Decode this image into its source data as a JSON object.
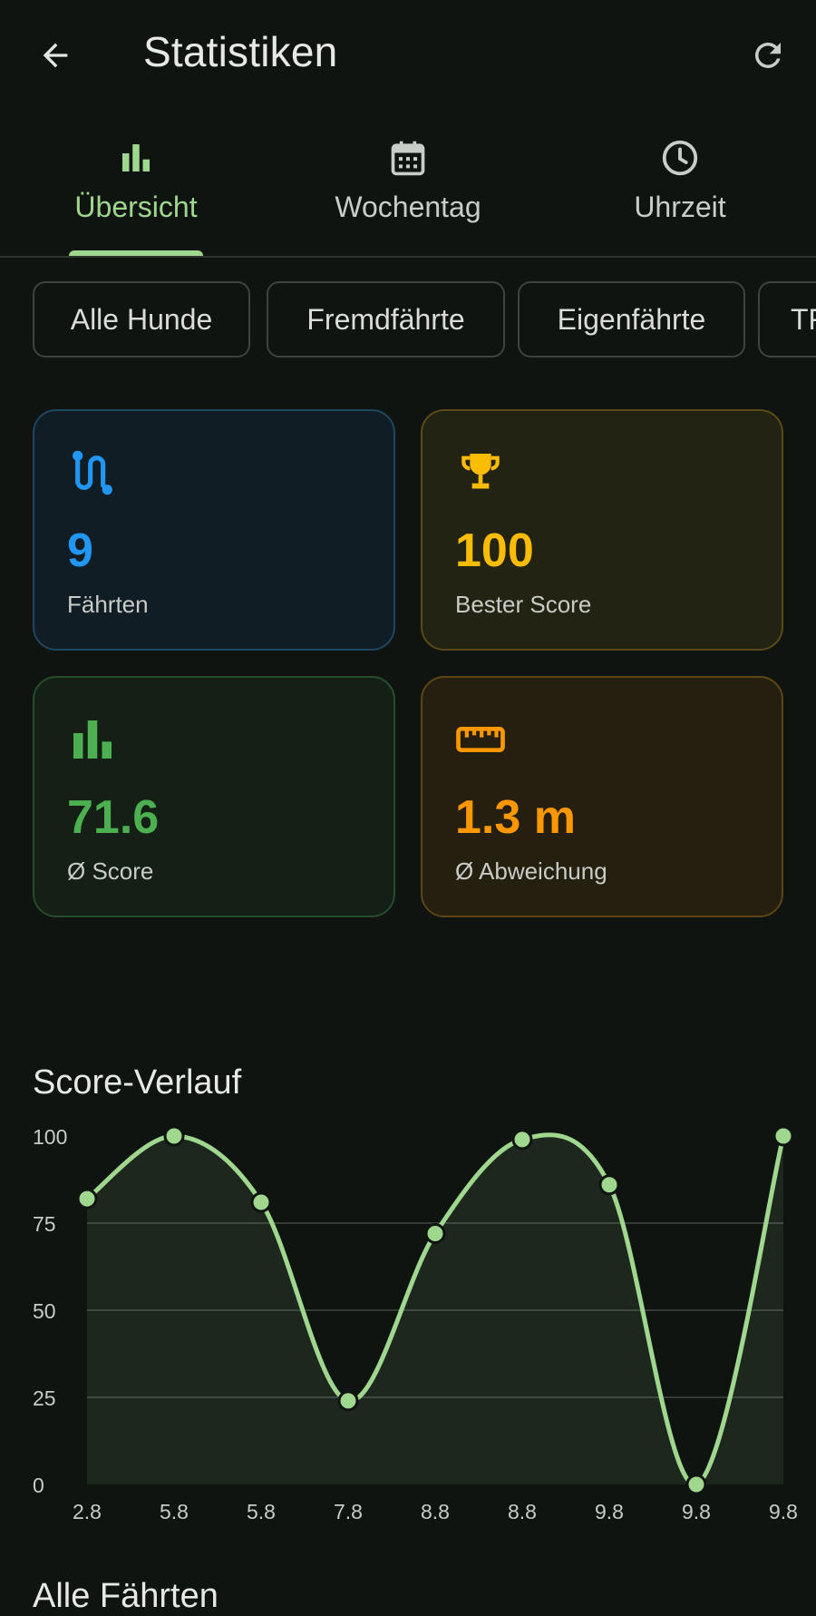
{
  "appbar": {
    "title": "Statistiken",
    "back_icon": "arrow-back-icon",
    "refresh_icon": "refresh-icon"
  },
  "tabs": [
    {
      "label": "Übersicht",
      "icon": "bar-chart-icon",
      "active": true
    },
    {
      "label": "Wochentag",
      "icon": "calendar-icon",
      "active": false
    },
    {
      "label": "Uhrzeit",
      "icon": "clock-icon",
      "active": false
    }
  ],
  "filters": [
    {
      "label": "Alle Hunde"
    },
    {
      "label": "Fremdfährte"
    },
    {
      "label": "Eigenfährte"
    },
    {
      "label": "TF"
    }
  ],
  "stats": {
    "runs": {
      "value": "9",
      "label": "Fährten",
      "icon": "route-icon",
      "color": "#2196f3"
    },
    "best": {
      "value": "100",
      "label": "Bester Score",
      "icon": "trophy-icon",
      "color": "#fbbc05"
    },
    "avg": {
      "value": "71.6",
      "label": "Ø Score",
      "icon": "bar-chart-icon",
      "color": "#4caf50"
    },
    "deviation": {
      "value": "1.3 m",
      "label": "Ø Abweichung",
      "icon": "ruler-icon",
      "color": "#ff9800"
    }
  },
  "chart": {
    "title": "Score-Verlauf"
  },
  "chart_data": {
    "type": "line",
    "categories": [
      "2.8",
      "5.8",
      "5.8",
      "7.8",
      "8.8",
      "8.8",
      "9.8",
      "9.8",
      "9.8"
    ],
    "values": [
      82,
      100,
      81,
      24,
      72,
      99,
      86,
      0,
      100
    ],
    "ylim": [
      0,
      100
    ],
    "yticks": [
      0,
      25,
      50,
      75,
      100
    ],
    "grid": true,
    "line_color": "#9fd78e"
  },
  "section": {
    "all_runs_title": "Alle Fährten"
  }
}
